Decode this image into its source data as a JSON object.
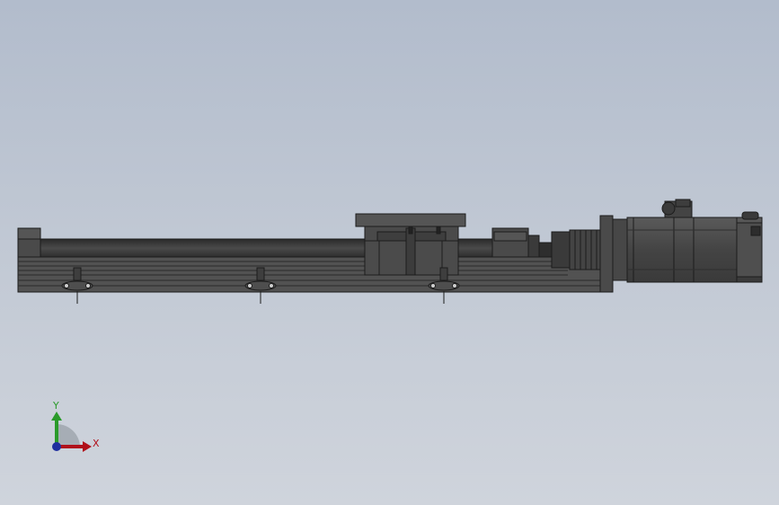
{
  "viewport": {
    "background_top": "#b2bccc",
    "background_bottom": "#cfd4dc"
  },
  "model": {
    "body_color": "#4a4a4a",
    "edge_color": "#1c1c1c",
    "highlight_color": "#6e6e6e"
  },
  "triad": {
    "x_label": "X",
    "y_label": "Y",
    "x_color": "#b0101a",
    "y_color": "#2a9a2a",
    "z_color": "#1f2f9f"
  }
}
